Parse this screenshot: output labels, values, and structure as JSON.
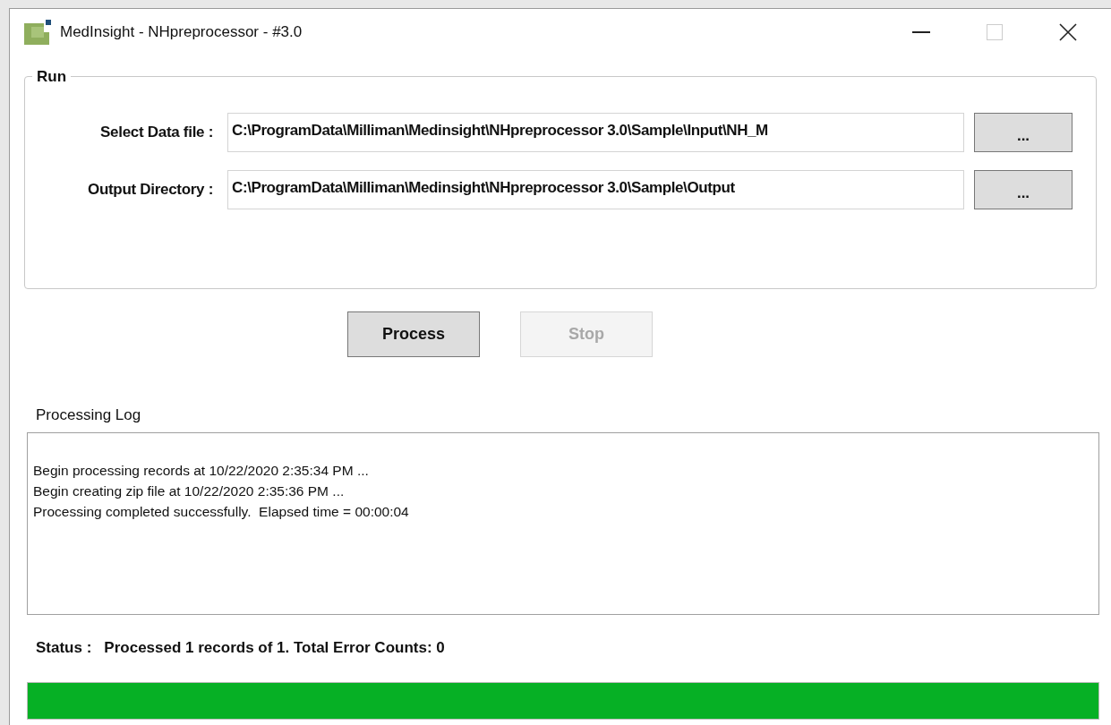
{
  "window": {
    "title": "MedInsight - NHpreprocessor - #3.0"
  },
  "run_group": {
    "title": "Run",
    "fields": [
      {
        "label": "Select Data file :",
        "value": "C:\\ProgramData\\Milliman\\Medinsight\\NHpreprocessor 3.0\\Sample\\Input\\NH_M",
        "browse": "..."
      },
      {
        "label": "Output Directory :",
        "value": "C:\\ProgramData\\Milliman\\Medinsight\\NHpreprocessor 3.0\\Sample\\Output",
        "browse": "..."
      }
    ]
  },
  "actions": [
    {
      "label": "Process",
      "disabled": false
    },
    {
      "label": "Stop",
      "disabled": true
    }
  ],
  "log": {
    "title": "Processing Log",
    "lines": [
      "Begin processing records at 10/22/2020 2:35:34 PM ...",
      "Begin creating zip file at 10/22/2020 2:35:36 PM ...",
      "Processing completed successfully.  Elapsed time = 00:00:04"
    ]
  },
  "status": {
    "label": "Status :",
    "text": "Processed 1 records of 1. Total Error Counts: 0"
  },
  "progress": {
    "level": 1
  }
}
